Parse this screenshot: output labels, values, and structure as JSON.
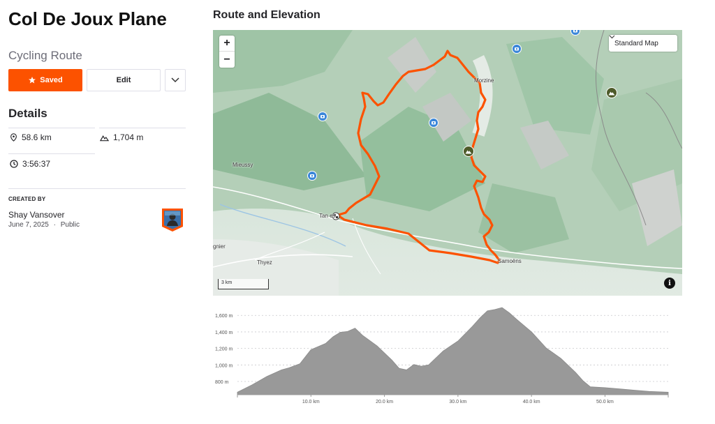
{
  "route": {
    "title": "Col De Joux Plane",
    "type": "Cycling Route"
  },
  "actions": {
    "saved_label": "Saved",
    "edit_label": "Edit"
  },
  "details": {
    "title": "Details",
    "distance": "58.6 km",
    "elevation_gain": "1,704 m",
    "moving_time": "3:56:37"
  },
  "creator": {
    "label": "CREATED BY",
    "name": "Shay Vansover",
    "date": "June 7, 2025",
    "visibility": "Public",
    "separator": "·"
  },
  "map": {
    "section_title": "Route and Elevation",
    "zoom_in": "+",
    "zoom_out": "−",
    "map_type": "Standard Map",
    "scale_label": "3 km",
    "info": "i",
    "places": {
      "morzine": "Morzine",
      "mieussy": "Mieussy",
      "taninges": "Tan  es",
      "samoens": "Samoëns",
      "thyez": "Thyez",
      "marignier": "gnier"
    },
    "route_color": "#fc5200"
  },
  "chart_data": {
    "type": "area",
    "xlabel": "",
    "ylabel": "",
    "x_unit": "km",
    "y_unit": "m",
    "xlim": [
      0,
      58.6
    ],
    "ylim": [
      640,
      1720
    ],
    "x_ticks": [
      "10.0 km",
      "20.0 km",
      "30.0 km",
      "40.0 km",
      "50.0 km"
    ],
    "x_tick_values": [
      10,
      20,
      30,
      40,
      50
    ],
    "y_ticks": [
      "800 m",
      "1,000 m",
      "1,200 m",
      "1,400 m",
      "1,600 m"
    ],
    "y_tick_values": [
      800,
      1000,
      1200,
      1400,
      1600
    ],
    "x": [
      0,
      2,
      4,
      6,
      7,
      8.5,
      10,
      12,
      13,
      14,
      15,
      16,
      17,
      19,
      21,
      22,
      23,
      24,
      25,
      26,
      28,
      30,
      32,
      33,
      34,
      35,
      36,
      37,
      38,
      40,
      42,
      44,
      46,
      47,
      48,
      50,
      52,
      54,
      56,
      58.6
    ],
    "elevation": [
      670,
      760,
      860,
      940,
      965,
      1015,
      1185,
      1260,
      1340,
      1395,
      1405,
      1445,
      1360,
      1230,
      1060,
      960,
      940,
      1005,
      985,
      1000,
      1170,
      1290,
      1470,
      1570,
      1655,
      1670,
      1695,
      1630,
      1550,
      1400,
      1205,
      1080,
      910,
      810,
      735,
      725,
      710,
      695,
      680,
      670
    ],
    "color": "#999999"
  }
}
